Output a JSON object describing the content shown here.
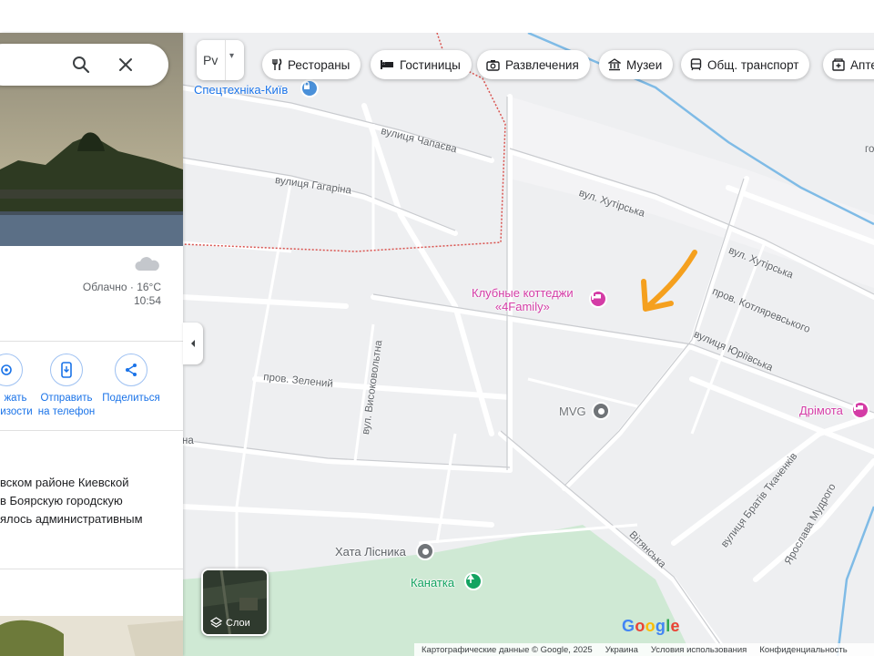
{
  "side_panel": {
    "weather_text": "Облачно · 16°C",
    "weather_time": "10:54",
    "actions": [
      {
        "label_line1": "жать",
        "label_line2": "изости"
      },
      {
        "label_line1": "Отправить",
        "label_line2": "на телефон"
      },
      {
        "label_line1": "Поделиться",
        "label_line2": ""
      }
    ],
    "description_lines": [
      "вском районе Киевской",
      "в Боярскую городскую",
      "ялось административным"
    ]
  },
  "map_type": {
    "value": "Pv"
  },
  "chips": [
    {
      "label": "Рестораны",
      "icon": "restaurant-icon"
    },
    {
      "label": "Гостиницы",
      "icon": "hotel-icon"
    },
    {
      "label": "Развлечения",
      "icon": "camera-icon"
    },
    {
      "label": "Музеи",
      "icon": "museum-icon"
    },
    {
      "label": "Общ. транспорт",
      "icon": "transit-icon"
    },
    {
      "label": "Апте",
      "icon": "pharmacy-icon"
    }
  ],
  "streets": [
    {
      "text": "вулиця Чапаєва"
    },
    {
      "text": "вулиця Гагаріна"
    },
    {
      "text": "вул. Хутірська"
    },
    {
      "text": "вул. Хутірська"
    },
    {
      "text": "пров. Котляревського"
    },
    {
      "text": "вулиця Юріївська"
    },
    {
      "text": "пров. Зелений"
    },
    {
      "text": "вул. Високовольтна"
    },
    {
      "text": "вулиця Братів Ткаченків"
    },
    {
      "text": "Ярослава Мудрого"
    },
    {
      "text": "Вітянська"
    },
    {
      "text": "на"
    },
    {
      "text": "го"
    }
  ],
  "pois": {
    "spectehnika": "Спецтехніка-Київ",
    "cottages_line1": "Клубные коттеджи",
    "cottages_line2": "«4Family»",
    "mvg": "MVG",
    "drimota": "Дрімота",
    "hata": "Хата Лісника",
    "kanatka": "Канатка"
  },
  "layers_label": "Слои",
  "google_logo": {
    "letters": [
      "G",
      "o",
      "o",
      "g",
      "l",
      "e"
    ],
    "colors": [
      "#4285f4",
      "#ea4335",
      "#fbbc05",
      "#4285f4",
      "#34a853",
      "#ea4335"
    ]
  },
  "footer": [
    "Картографические данные © Google, 2025",
    "Украина",
    "Условия использования",
    "Конфиденциальность"
  ],
  "colors": {
    "hotel_pink": "#d43ca6",
    "poi_gray": "#707478",
    "park_green": "#14a361",
    "arrow_orange": "#f5a01e",
    "water_blue": "#7fbbe6"
  }
}
